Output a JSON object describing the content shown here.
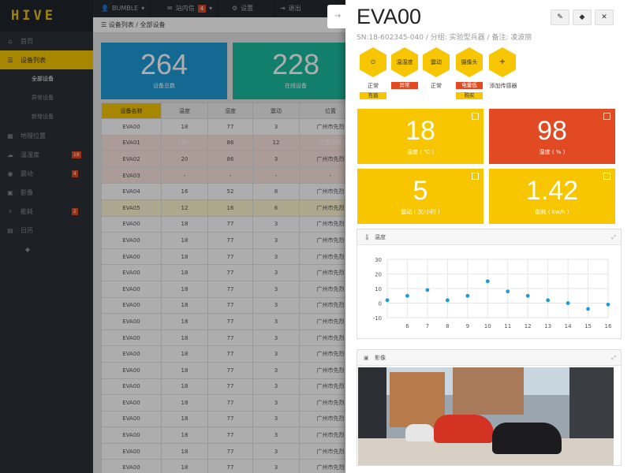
{
  "app": {
    "logo": "HIVE"
  },
  "topbar": {
    "user": "BUMBLE",
    "messages_label": "站内信",
    "messages_count": "4",
    "settings_label": "设置",
    "logout_label": "退出"
  },
  "sidebar": {
    "home": "首页",
    "devices": "设备列表",
    "sub": [
      "全部设备",
      "异常设备",
      "新增设备"
    ],
    "location": "地理位置",
    "temp": "温湿度",
    "temp_badge": "18",
    "vibration": "震动",
    "vibration_badge": "4",
    "video": "影像",
    "power": "能耗",
    "power_badge": "2",
    "calendar": "日历"
  },
  "breadcrumb": "设备列表 / 全部设备",
  "stats": [
    {
      "value": "264",
      "label": "设备总数",
      "color": "#1e9bd8"
    },
    {
      "value": "228",
      "label": "在线设备",
      "color": "#1bbca0"
    }
  ],
  "table": {
    "headers": [
      "设备名称",
      "温度",
      "湿度",
      "震动",
      "位置"
    ],
    "rows": [
      [
        "EVA00",
        "18",
        "77",
        "3",
        "广州市先烈"
      ],
      [
        "EVA01",
        "35",
        "86",
        "12",
        "位置异常"
      ],
      [
        "EVA02",
        "20",
        "86",
        "3",
        "广州市先烈"
      ],
      [
        "EVA03",
        "-",
        "-",
        "-",
        "-"
      ],
      [
        "EVA04",
        "16",
        "52",
        "8",
        "广州市先烈"
      ],
      [
        "EVA05",
        "12",
        "16",
        "6",
        "广州市先烈"
      ],
      [
        "EVA00",
        "18",
        "77",
        "3",
        "广州市先烈"
      ],
      [
        "EVA00",
        "18",
        "77",
        "3",
        "广州市先烈"
      ],
      [
        "EVA00",
        "18",
        "77",
        "3",
        "广州市先烈"
      ],
      [
        "EVA00",
        "18",
        "77",
        "3",
        "广州市先烈"
      ],
      [
        "EVA00",
        "18",
        "77",
        "3",
        "广州市先烈"
      ],
      [
        "EVA00",
        "18",
        "77",
        "3",
        "广州市先烈"
      ],
      [
        "EVA00",
        "18",
        "77",
        "3",
        "广州市先烈"
      ],
      [
        "EVA00",
        "18",
        "77",
        "3",
        "广州市先烈"
      ],
      [
        "EVA00",
        "18",
        "77",
        "3",
        "广州市先烈"
      ],
      [
        "EVA00",
        "18",
        "77",
        "3",
        "广州市先烈"
      ],
      [
        "EVA00",
        "18",
        "77",
        "3",
        "广州市先烈"
      ],
      [
        "EVA00",
        "18",
        "77",
        "3",
        "广州市先烈"
      ],
      [
        "EVA00",
        "18",
        "77",
        "3",
        "广州市先烈"
      ],
      [
        "EVA00",
        "18",
        "77",
        "3",
        "广州市先烈"
      ],
      [
        "EVA00",
        "18",
        "77",
        "3",
        "广州市先烈"
      ],
      [
        "EVA00",
        "18",
        "77",
        "3",
        "广州市先烈"
      ]
    ]
  },
  "panel": {
    "title": "EVA00",
    "subtitle": "SN:18-602345-040 / 分组: 实验型兵器 / 备注: 凌波丽",
    "sensors": [
      {
        "label": "温湿度",
        "status": "异常",
        "status_type": "red"
      },
      {
        "label": "震动",
        "status": "正常",
        "status_type": ""
      },
      {
        "label": "摄像头",
        "status": "电量低",
        "status_type": "red",
        "action": "购买"
      },
      {
        "label": "+",
        "status": "添加传感器",
        "status_type": ""
      }
    ],
    "power": {
      "status": "正常",
      "action": "充值"
    },
    "tiles": [
      {
        "value": "18",
        "label": "温度 ( ℃ )",
        "color": "#f7c600"
      },
      {
        "value": "98",
        "label": "湿度 ( % )",
        "color": "#e14a23"
      },
      {
        "value": "5",
        "label": "震动 ( 次/小时 )",
        "color": "#f7c600"
      },
      {
        "value": "1.42",
        "label": "能耗 ( kw/h )",
        "color": "#f7c600"
      }
    ],
    "chart_card_title": "温度",
    "image_card_title": "影像"
  },
  "chart_data": {
    "type": "scatter",
    "x": [
      5,
      6,
      7,
      8,
      9,
      10,
      11,
      12,
      13,
      14,
      15,
      16
    ],
    "y": [
      2,
      5,
      9,
      2,
      5,
      15,
      8,
      5,
      2,
      0,
      -4,
      -1
    ],
    "xticks": [
      6,
      7,
      8,
      9,
      10,
      11,
      12,
      13,
      14,
      15,
      16
    ],
    "yticks": [
      30,
      20,
      10,
      0,
      -10
    ],
    "xlim": [
      5,
      16
    ],
    "ylim": [
      -10,
      30
    ],
    "grid": true,
    "color": "#1e9bd8"
  }
}
